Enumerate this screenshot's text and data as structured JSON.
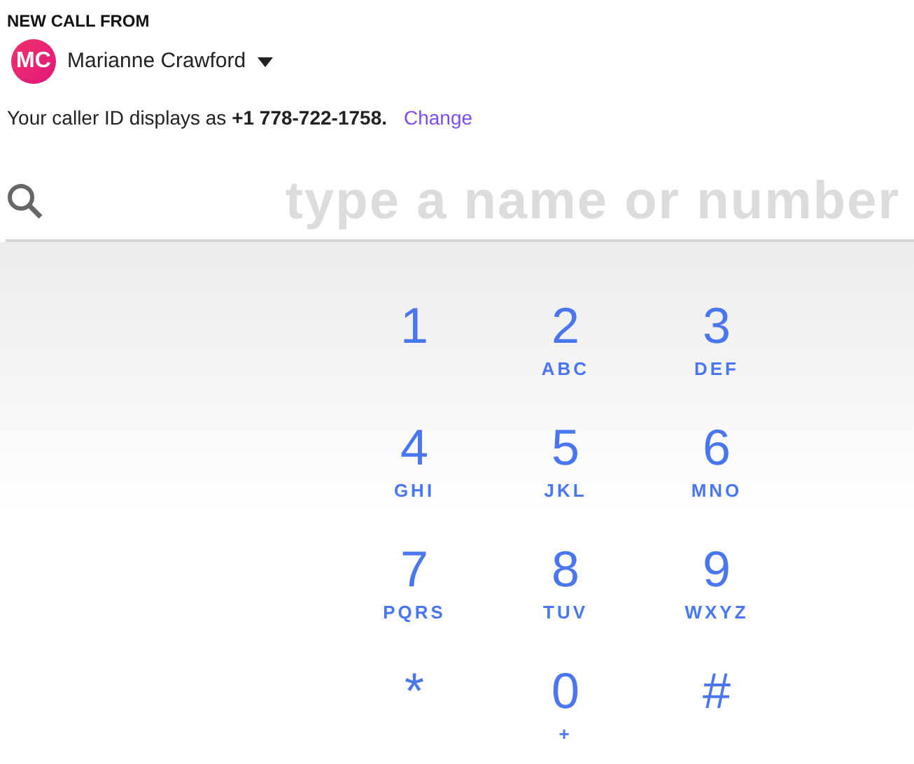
{
  "header": {
    "title": "NEW CALL FROM",
    "avatar_initials": "MC",
    "caller_name": "Marianne Crawford"
  },
  "caller_id": {
    "text": "Your caller ID displays as **+1 778-722-1758.**",
    "link": "Change"
  },
  "search": {
    "placeholder": "type a name or number"
  },
  "keypad": [
    {
      "digit": "1"
    },
    {
      "digit": "2",
      "letters": "ABC"
    },
    {
      "digit": "3",
      "letters": "DEF"
    },
    {
      "digit": "4",
      "letters": "GHI"
    },
    {
      "digit": "5",
      "letters": "JKL"
    },
    {
      "digit": "6",
      "letters": "MNO"
    },
    {
      "digit": "7",
      "letters": "PQRS"
    },
    {
      "digit": "8",
      "letters": "TUV"
    },
    {
      "digit": "9",
      "letters": "WXYZ"
    },
    {
      "digit": "*"
    },
    {
      "digit": "0",
      "letters": "+"
    },
    {
      "digit": "#"
    }
  ]
}
